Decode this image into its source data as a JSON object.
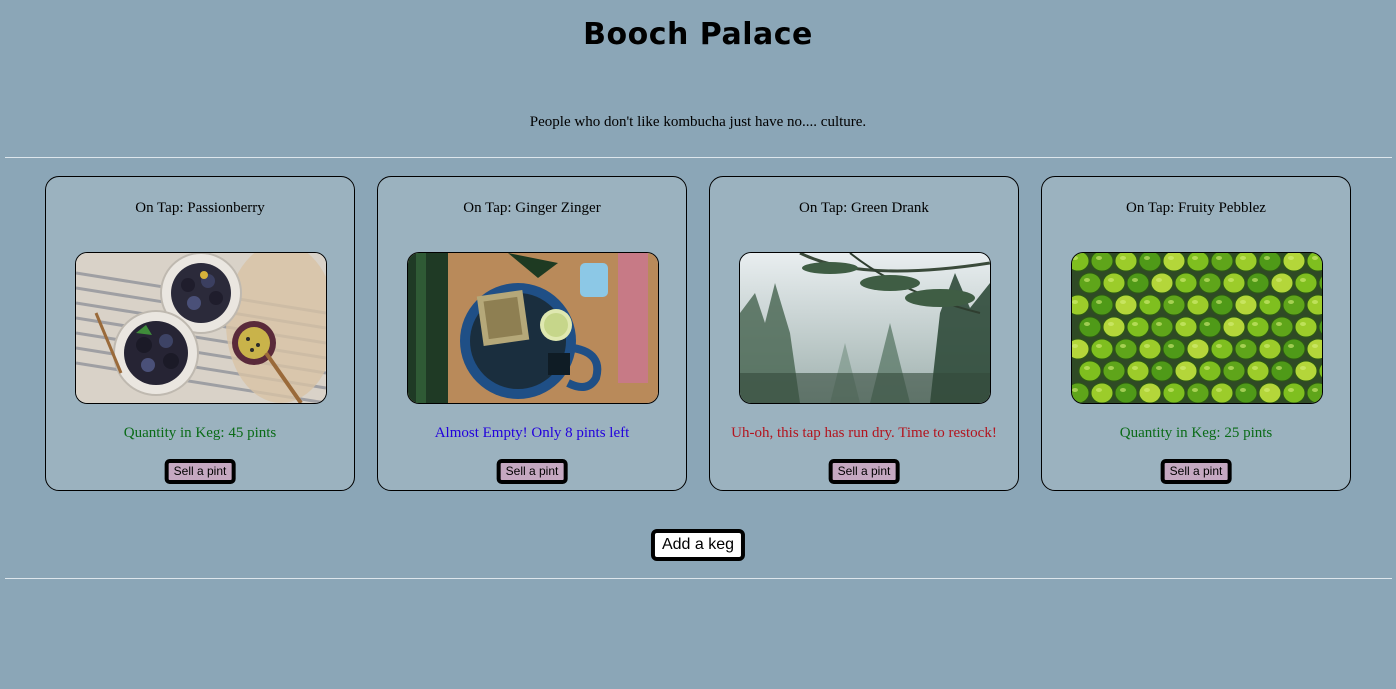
{
  "header": {
    "title": "Booch Palace",
    "tagline": "People who don't like kombucha just have no.... culture."
  },
  "kegs": [
    {
      "name": "On Tap: Passionberry",
      "status": "Quantity in Keg: 45 pints",
      "status_color": "#0a6b17",
      "sell_label": "Sell a pint",
      "image": "berry-bowls-photo"
    },
    {
      "name": "On Tap: Ginger Zinger",
      "status": "Almost Empty! Only 8 pints left",
      "status_color": "#2200dd",
      "sell_label": "Sell a pint",
      "image": "tea-mug-photo"
    },
    {
      "name": "On Tap: Green Drank",
      "status": "Uh-oh, this tap has run dry. Time to restock!",
      "status_color": "#b3141e",
      "sell_label": "Sell a pint",
      "image": "misty-forest-photo"
    },
    {
      "name": "On Tap: Fruity Pebblez",
      "status": "Quantity in Keg: 25 pints",
      "status_color": "#0a6b17",
      "sell_label": "Sell a pint",
      "image": "limes-photo"
    }
  ],
  "actions": {
    "add_keg_label": "Add a keg"
  },
  "colors": {
    "background": "#8ba6b7",
    "card": "#9bb2bf",
    "sell_button": "#c5a8c1"
  }
}
